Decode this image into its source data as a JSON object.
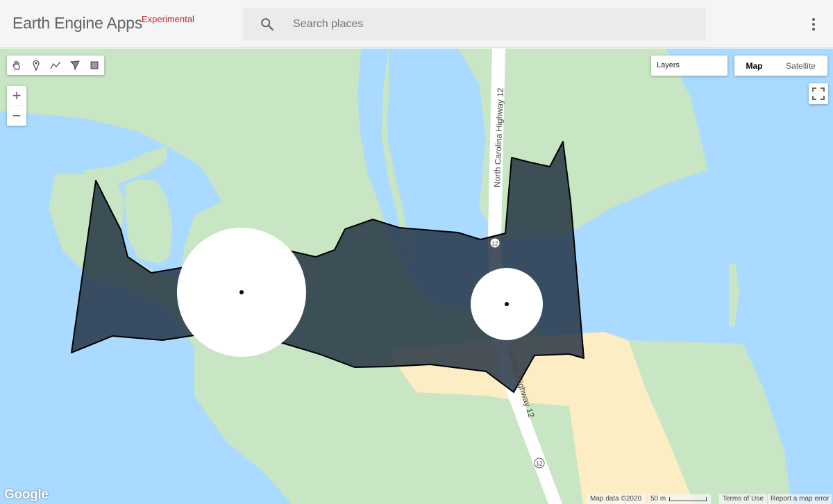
{
  "app": {
    "title": "Earth Engine Apps",
    "badge": "Experimental"
  },
  "search": {
    "placeholder": "Search places",
    "icon": "search-icon"
  },
  "menu": {
    "icon": "more-vert-icon"
  },
  "map": {
    "drawing_tools": [
      "hand-icon",
      "marker-icon",
      "line-icon",
      "polygon-icon",
      "rectangle-icon"
    ],
    "zoom": {
      "in_label": "+",
      "out_label": "−"
    },
    "layers_label": "Layers",
    "map_type": {
      "selected": "Map",
      "options": [
        "Map",
        "Satellite"
      ]
    },
    "fullscreen_icon": "fullscreen-icon",
    "road_labels": [
      "North Carolina Highway 12",
      "Carolina Highway 12"
    ],
    "route_shield": "12",
    "colors": {
      "water": "#aadaff",
      "land": "#c8e6c3",
      "sand": "#fdedc4",
      "polygon": "#1f2d3d",
      "road": "#ffffff"
    },
    "footer": {
      "logo": "Google",
      "map_data": "Map data ©2020",
      "scale": "50 m",
      "terms": "Terms of Use",
      "report": "Report a map error"
    }
  }
}
